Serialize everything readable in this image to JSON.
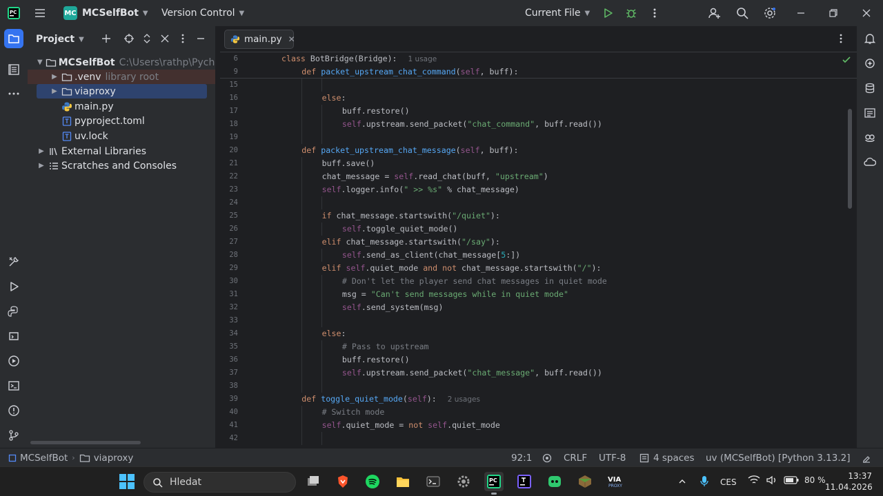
{
  "titlebar": {
    "logo_text": "MC",
    "project_name": "MCSelfBot",
    "vcs": "Version Control",
    "run_config": "Current File"
  },
  "project_panel": {
    "title": "Project",
    "tree": [
      {
        "name": "MCSelfBot",
        "hint": "C:\\Users\\rathp\\PycharmProjects\\MCSelfBot",
        "icon": "folder-icon"
      },
      {
        "name": ".venv",
        "hint": "library root",
        "icon": "folder-icon"
      },
      {
        "name": "viaproxy",
        "hint": "",
        "icon": "folder-icon"
      },
      {
        "name": "main.py",
        "hint": "",
        "icon": "python-file-icon"
      },
      {
        "name": "pyproject.toml",
        "hint": "",
        "icon": "text-file-icon"
      },
      {
        "name": "uv.lock",
        "hint": "",
        "icon": "text-file-icon"
      },
      {
        "name": "External Libraries",
        "hint": "",
        "icon": "library-icon"
      },
      {
        "name": "Scratches and Consoles",
        "hint": "",
        "icon": "scratches-icon"
      }
    ]
  },
  "editor": {
    "tab": "main.py",
    "sticky": [
      {
        "ln": "6",
        "parts": [
          [
            "kw",
            "class "
          ],
          [
            "",
            "BotBridge(Bridge):"
          ]
        ],
        "hint": "1 usage"
      },
      {
        "ln": "9",
        "parts": [
          [
            "kw",
            "def "
          ],
          [
            "fn",
            "packet_upstream_chat_command"
          ],
          [
            "",
            "("
          ],
          [
            "self",
            "self"
          ],
          [
            "",
            ", buff):"
          ]
        ]
      }
    ],
    "lines": [
      {
        "ln": "15",
        "indent": 0,
        "parts": []
      },
      {
        "ln": "16",
        "indent": 2,
        "parts": [
          [
            "kw",
            "else"
          ],
          [
            "",
            ":"
          ]
        ]
      },
      {
        "ln": "17",
        "indent": 3,
        "parts": [
          [
            "",
            "buff.restore()"
          ]
        ]
      },
      {
        "ln": "18",
        "indent": 3,
        "parts": [
          [
            "self",
            "self"
          ],
          [
            "",
            ".upstream.send_packet("
          ],
          [
            "str",
            "\"chat_command\""
          ],
          [
            "",
            ", buff.read())"
          ]
        ]
      },
      {
        "ln": "19",
        "indent": 0,
        "parts": []
      },
      {
        "ln": "20",
        "indent": 1,
        "parts": [
          [
            "kw",
            "def "
          ],
          [
            "fn",
            "packet_upstream_chat_message"
          ],
          [
            "",
            "("
          ],
          [
            "self",
            "self"
          ],
          [
            "",
            ", buff):"
          ]
        ]
      },
      {
        "ln": "21",
        "indent": 2,
        "parts": [
          [
            "",
            "buff.save()"
          ]
        ]
      },
      {
        "ln": "22",
        "indent": 2,
        "parts": [
          [
            "",
            "chat_message = "
          ],
          [
            "self",
            "self"
          ],
          [
            "",
            ".read_chat(buff, "
          ],
          [
            "str",
            "\"upstream\""
          ],
          [
            "",
            ")"
          ]
        ]
      },
      {
        "ln": "23",
        "indent": 2,
        "parts": [
          [
            "self",
            "self"
          ],
          [
            "",
            ".logger.info("
          ],
          [
            "str",
            "\" >> %s\""
          ],
          [
            "",
            " % chat_message)"
          ]
        ]
      },
      {
        "ln": "24",
        "indent": 0,
        "parts": []
      },
      {
        "ln": "25",
        "indent": 2,
        "parts": [
          [
            "kw",
            "if "
          ],
          [
            "",
            "chat_message.startswith("
          ],
          [
            "str",
            "\"/quiet\""
          ],
          [
            "",
            "):"
          ]
        ]
      },
      {
        "ln": "26",
        "indent": 3,
        "parts": [
          [
            "self",
            "self"
          ],
          [
            "",
            ".toggle_quiet_mode()"
          ]
        ]
      },
      {
        "ln": "27",
        "indent": 2,
        "parts": [
          [
            "kw",
            "elif "
          ],
          [
            "",
            "chat_message.startswith("
          ],
          [
            "str",
            "\"/say\""
          ],
          [
            "",
            "):"
          ]
        ]
      },
      {
        "ln": "28",
        "indent": 3,
        "parts": [
          [
            "self",
            "self"
          ],
          [
            "",
            ".send_as_client(chat_message["
          ],
          [
            "num",
            "5"
          ],
          [
            "",
            ":])"
          ]
        ]
      },
      {
        "ln": "29",
        "indent": 2,
        "parts": [
          [
            "kw",
            "elif "
          ],
          [
            "self",
            "self"
          ],
          [
            "",
            ".quiet_mode "
          ],
          [
            "kw",
            "and not "
          ],
          [
            "",
            "chat_message.startswith("
          ],
          [
            "str",
            "\"/\""
          ],
          [
            "",
            "):"
          ]
        ]
      },
      {
        "ln": "30",
        "indent": 3,
        "parts": [
          [
            "cmt",
            "# Don't let the player send chat messages in quiet mode"
          ]
        ]
      },
      {
        "ln": "31",
        "indent": 3,
        "parts": [
          [
            "",
            "msg = "
          ],
          [
            "str",
            "\"Can't send messages while in quiet mode\""
          ]
        ]
      },
      {
        "ln": "32",
        "indent": 3,
        "parts": [
          [
            "self",
            "self"
          ],
          [
            "",
            ".send_system(msg)"
          ]
        ]
      },
      {
        "ln": "33",
        "indent": 0,
        "parts": []
      },
      {
        "ln": "34",
        "indent": 2,
        "parts": [
          [
            "kw",
            "else"
          ],
          [
            "",
            ":"
          ]
        ]
      },
      {
        "ln": "35",
        "indent": 3,
        "parts": [
          [
            "cmt",
            "# Pass to upstream"
          ]
        ]
      },
      {
        "ln": "36",
        "indent": 3,
        "parts": [
          [
            "",
            "buff.restore()"
          ]
        ]
      },
      {
        "ln": "37",
        "indent": 3,
        "parts": [
          [
            "self",
            "self"
          ],
          [
            "",
            ".upstream.send_packet("
          ],
          [
            "str",
            "\"chat_message\""
          ],
          [
            "",
            ", buff.read())"
          ]
        ]
      },
      {
        "ln": "38",
        "indent": 0,
        "parts": []
      },
      {
        "ln": "39",
        "indent": 1,
        "parts": [
          [
            "kw",
            "def "
          ],
          [
            "fn",
            "toggle_quiet_mode"
          ],
          [
            "",
            "("
          ],
          [
            "self",
            "self"
          ],
          [
            "",
            "):"
          ]
        ],
        "hint": "2 usages"
      },
      {
        "ln": "40",
        "indent": 2,
        "parts": [
          [
            "cmt",
            "# Switch mode"
          ]
        ]
      },
      {
        "ln": "41",
        "indent": 2,
        "parts": [
          [
            "self",
            "self"
          ],
          [
            "",
            ".quiet_mode = "
          ],
          [
            "kw",
            "not "
          ],
          [
            "self",
            "self"
          ],
          [
            "",
            ".quiet_mode"
          ]
        ]
      },
      {
        "ln": "42",
        "indent": 0,
        "parts": []
      }
    ]
  },
  "statusbar": {
    "breadcrumb_project": "MCSelfBot",
    "breadcrumb_folder": "viaproxy",
    "position": "92:1",
    "line_sep": "CRLF",
    "encoding": "UTF-8",
    "indent": "4 spaces",
    "interpreter": "uv (MCSelfBot) [Python 3.13.2]"
  },
  "taskbar": {
    "search_placeholder": "Hledat",
    "language": "CES",
    "battery": "80 %",
    "time": "13:37",
    "date": "11.04.2026"
  },
  "colors": {
    "accent": "#3574f0",
    "selection": "#2e436e",
    "venv_row": "#43302f"
  }
}
